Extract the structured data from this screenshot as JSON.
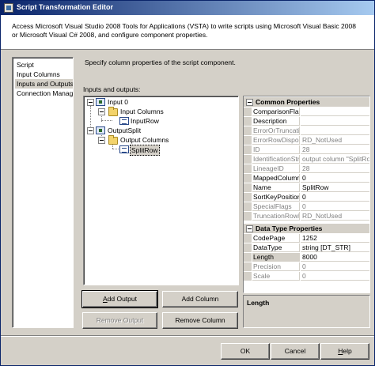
{
  "window": {
    "title": "Script Transformation Editor"
  },
  "header": {
    "description": "Access Microsoft Visual Studio 2008 Tools for Applications (VSTA) to write scripts using Microsoft Visual Basic 2008 or Microsoft Visual C# 2008, and configure component properties."
  },
  "nav": {
    "items": [
      {
        "label": "Script"
      },
      {
        "label": "Input Columns"
      },
      {
        "label": "Inputs and Outputs",
        "selected": true
      },
      {
        "label": "Connection Managers"
      }
    ]
  },
  "main": {
    "page_description": "Specify column properties of the script component.",
    "io_label": "Inputs and outputs:",
    "tree": {
      "input": "Input 0",
      "input_columns": "Input Columns",
      "input_row": "InputRow",
      "output": "OutputSplit",
      "output_columns": "Output Columns",
      "split_row": "SplitRow"
    },
    "buttons": {
      "add_output": "Add Output",
      "add_column": "Add Column",
      "remove_output": "Remove Output",
      "remove_column": "Remove Column"
    }
  },
  "properties": {
    "common_title": "Common Properties",
    "common": [
      {
        "name": "ComparisonFlags",
        "value": "",
        "readonly": false
      },
      {
        "name": "Description",
        "value": "",
        "readonly": false
      },
      {
        "name": "ErrorOrTruncationOperation",
        "value": "",
        "readonly": true
      },
      {
        "name": "ErrorRowDisposition",
        "value": "RD_NotUsed",
        "readonly": true
      },
      {
        "name": "ID",
        "value": "28",
        "readonly": true
      },
      {
        "name": "IdentificationString",
        "value": "output column \"SplitRow\"",
        "readonly": true
      },
      {
        "name": "LineageID",
        "value": "28",
        "readonly": true
      },
      {
        "name": "MappedColumnID",
        "value": "0",
        "readonly": false
      },
      {
        "name": "Name",
        "value": "SplitRow",
        "readonly": false
      },
      {
        "name": "SortKeyPosition",
        "value": "0",
        "readonly": false
      },
      {
        "name": "SpecialFlags",
        "value": "0",
        "readonly": true
      },
      {
        "name": "TruncationRowDisposition",
        "value": "RD_NotUsed",
        "readonly": true
      }
    ],
    "datatype_title": "Data Type Properties",
    "datatype": [
      {
        "name": "CodePage",
        "value": "1252",
        "readonly": false
      },
      {
        "name": "DataType",
        "value": "string [DT_STR]",
        "readonly": false
      },
      {
        "name": "Length",
        "value": "8000",
        "readonly": false,
        "selected": true
      },
      {
        "name": "Precision",
        "value": "0",
        "readonly": true
      },
      {
        "name": "Scale",
        "value": "0",
        "readonly": true
      }
    ],
    "description_title": "Length"
  },
  "footer": {
    "ok": "OK",
    "cancel": "Cancel",
    "help": "Help"
  }
}
